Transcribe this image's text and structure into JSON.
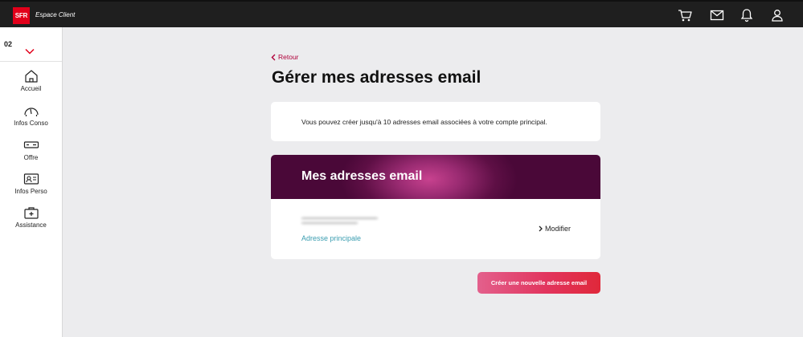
{
  "header": {
    "logo_text": "SFR",
    "brand": "Espace Client",
    "icons": [
      "cart-icon",
      "mail-icon",
      "notification-bell-icon",
      "user-account-icon"
    ]
  },
  "sidebar": {
    "line_number": "02",
    "items": [
      {
        "label": "Accueil",
        "icon": "home-icon"
      },
      {
        "label": "Infos Conso",
        "icon": "gauge-icon"
      },
      {
        "label": "Offre",
        "icon": "offer-icon"
      },
      {
        "label": "Infos Perso",
        "icon": "id-card-icon"
      },
      {
        "label": "Assistance",
        "icon": "first-aid-icon"
      }
    ]
  },
  "main": {
    "back_label": "Retour",
    "title": "Gérer mes adresses email",
    "info_text": "Vous pouvez créer jusqu'à 10 adresses email associées à votre compte principal.",
    "email_section": {
      "header": "Mes adresses email",
      "address_label": "Adresse principale",
      "modify_label": "Modifier"
    },
    "create_button": "Créer une nouvelle adresse email"
  },
  "colors": {
    "brand_red": "#e2001a",
    "link": "#b0003a",
    "address_label": "#3a9db0",
    "banner": "#5e0f45"
  }
}
